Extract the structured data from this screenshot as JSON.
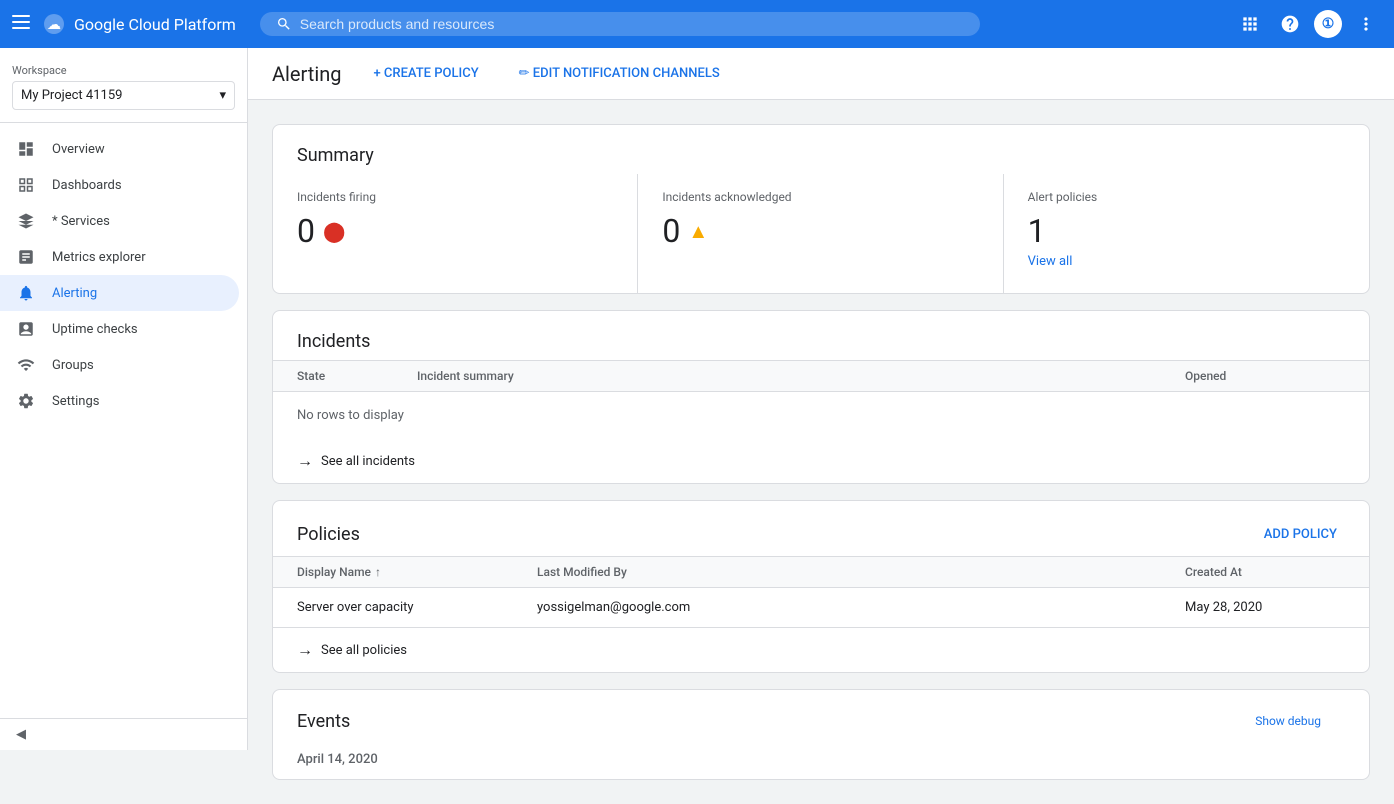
{
  "topbar": {
    "menu_icon": "☰",
    "logo_text": "Google Cloud Platform",
    "search_placeholder": "Search products and resources",
    "icons": [
      "⊟",
      "?",
      "①",
      "⋮"
    ]
  },
  "sidebar": {
    "workspace_label": "Workspace",
    "workspace_value": "My Project 41159",
    "dropdown_arrow": "▾",
    "nav_items": [
      {
        "id": "overview",
        "label": "Overview",
        "icon": "⊞"
      },
      {
        "id": "dashboards",
        "label": "Dashboards",
        "icon": "▦"
      },
      {
        "id": "services",
        "label": "* Services",
        "icon": "⬡"
      },
      {
        "id": "metrics-explorer",
        "label": "Metrics explorer",
        "icon": "📊"
      },
      {
        "id": "alerting",
        "label": "Alerting",
        "icon": "🔔",
        "active": true
      },
      {
        "id": "uptime-checks",
        "label": "Uptime checks",
        "icon": "⬜"
      },
      {
        "id": "groups",
        "label": "Groups",
        "icon": "▣"
      },
      {
        "id": "settings",
        "label": "Settings",
        "icon": "⚙"
      }
    ],
    "collapse_icon": "◀"
  },
  "page_header": {
    "title": "Alerting",
    "create_policy_label": "+ CREATE POLICY",
    "edit_channels_label": "✏ EDIT NOTIFICATION CHANNELS"
  },
  "summary": {
    "title": "Summary",
    "incidents_firing": {
      "label": "Incidents firing",
      "value": "0"
    },
    "incidents_acknowledged": {
      "label": "Incidents acknowledged",
      "value": "0"
    },
    "alert_policies": {
      "label": "Alert policies",
      "value": "1",
      "view_all": "View all"
    }
  },
  "incidents": {
    "title": "Incidents",
    "columns": [
      "State",
      "Incident summary",
      "Opened"
    ],
    "rows": [],
    "no_rows_message": "No rows to display",
    "see_all_label": "See all incidents"
  },
  "policies": {
    "title": "Policies",
    "add_label": "ADD POLICY",
    "columns": [
      "Display Name",
      "Last Modified By",
      "Created At"
    ],
    "rows": [
      {
        "display_name": "Server over capacity",
        "last_modified_by": "yossigelman@google.com",
        "created_at": "May 28, 2020"
      }
    ],
    "see_all_label": "See all policies"
  },
  "events": {
    "title": "Events",
    "date": "April 14, 2020",
    "show_debug": "Show debug"
  }
}
